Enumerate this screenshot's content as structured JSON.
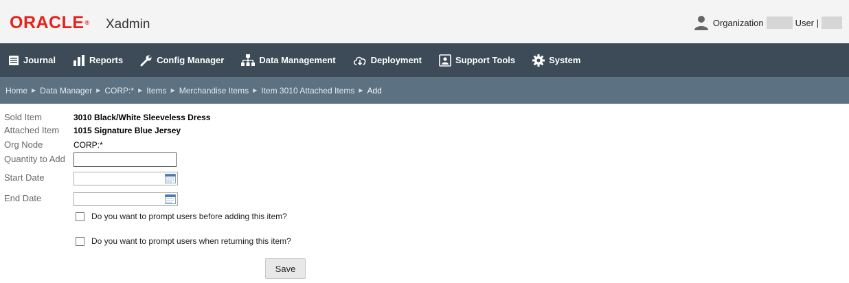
{
  "header": {
    "logo": "ORACLE",
    "app_name": "Xadmin",
    "organization_label": "Organization",
    "user_label": "User |"
  },
  "nav": {
    "items": [
      {
        "label": "Journal",
        "icon": "journal-icon"
      },
      {
        "label": "Reports",
        "icon": "reports-icon"
      },
      {
        "label": "Config Manager",
        "icon": "wrench-icon"
      },
      {
        "label": "Data Management",
        "icon": "hierarchy-icon"
      },
      {
        "label": "Deployment",
        "icon": "cloud-download-icon"
      },
      {
        "label": "Support Tools",
        "icon": "support-icon"
      },
      {
        "label": "System",
        "icon": "gear-icon"
      }
    ]
  },
  "breadcrumb": [
    "Home",
    "Data Manager",
    "CORP:*",
    "Items",
    "Merchandise Items",
    "Item 3010 Attached Items",
    "Add"
  ],
  "form": {
    "sold_item_label": "Sold Item",
    "sold_item_value": "3010 Black/White Sleeveless Dress",
    "attached_item_label": "Attached Item",
    "attached_item_value": "1015 Signature Blue Jersey",
    "org_node_label": "Org Node",
    "org_node_value": "CORP:*",
    "quantity_label": "Quantity to Add",
    "quantity_value": "",
    "start_date_label": "Start Date",
    "start_date_value": "",
    "end_date_label": "End Date",
    "end_date_value": "",
    "prompt_add_label": "Do you want to prompt users before adding this item?",
    "prompt_return_label": "Do you want to prompt users when returning this item?",
    "save_label": "Save"
  },
  "colors": {
    "brand_red": "#e8211b",
    "nav_bg": "#3c4b57",
    "breadcrumb_bg": "#5c7182"
  }
}
